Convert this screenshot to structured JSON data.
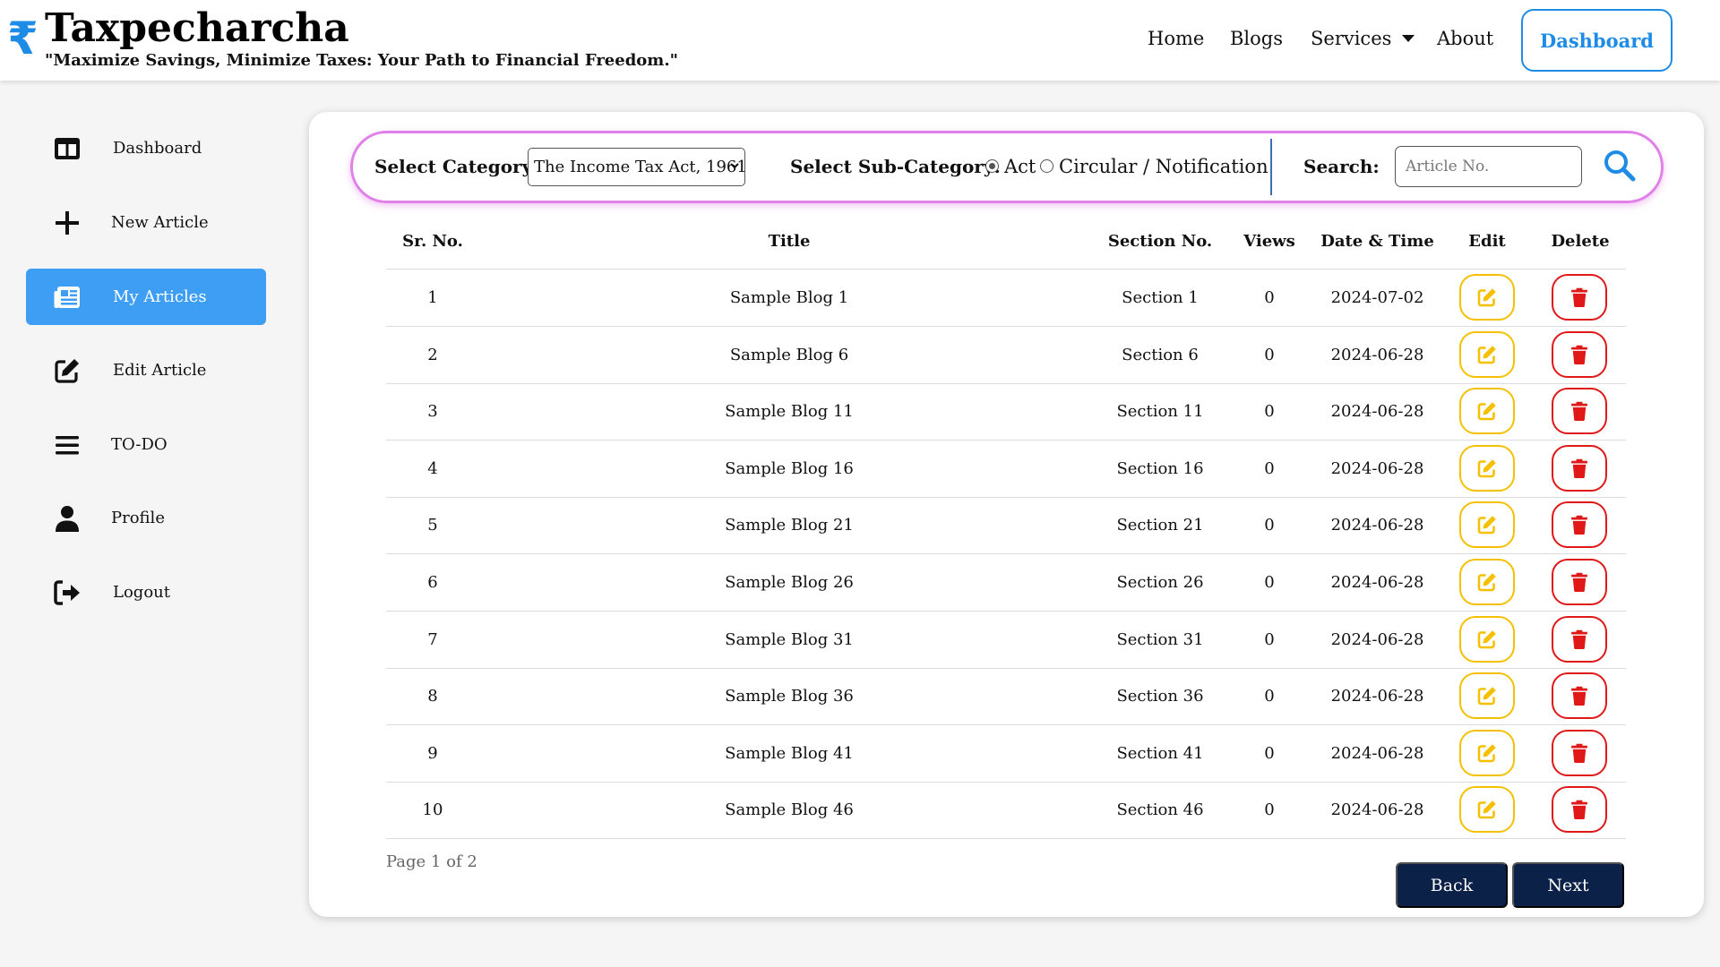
{
  "header": {
    "brand": "Taxpecharcha",
    "logo_glyph": "₹",
    "tagline": "\"Maximize Savings, Minimize Taxes: Your Path to Financial Freedom.\"",
    "nav": {
      "home": "Home",
      "blogs": "Blogs",
      "services": "Services",
      "about": "About"
    },
    "dashboard_button": "Dashboard"
  },
  "sidebar": {
    "items": [
      {
        "label": "Dashboard",
        "icon": "columns-icon"
      },
      {
        "label": "New Article",
        "icon": "plus-icon"
      },
      {
        "label": "My Articles",
        "icon": "newspaper-icon",
        "active": true
      },
      {
        "label": "Edit Article",
        "icon": "edit-icon"
      },
      {
        "label": "TO-DO",
        "icon": "list-icon"
      },
      {
        "label": "Profile",
        "icon": "user-icon"
      },
      {
        "label": "Logout",
        "icon": "logout-icon"
      }
    ]
  },
  "filters": {
    "category_label": "Select Category:",
    "category_value": "The Income Tax Act, 1961",
    "subcategory_label": "Select Sub-Category:",
    "subcategory_options": [
      "Act",
      "Circular / Notification"
    ],
    "subcategory_selected": "Act",
    "search_label": "Search:",
    "search_placeholder": "Article No."
  },
  "table": {
    "columns": [
      "Sr. No.",
      "Title",
      "Section No.",
      "Views",
      "Date & Time",
      "Edit",
      "Delete"
    ],
    "rows": [
      {
        "sr": "1",
        "title": "Sample Blog 1",
        "section": "Section 1",
        "views": "0",
        "date": "2024-07-02"
      },
      {
        "sr": "2",
        "title": "Sample Blog 6",
        "section": "Section 6",
        "views": "0",
        "date": "2024-06-28"
      },
      {
        "sr": "3",
        "title": "Sample Blog 11",
        "section": "Section 11",
        "views": "0",
        "date": "2024-06-28"
      },
      {
        "sr": "4",
        "title": "Sample Blog 16",
        "section": "Section 16",
        "views": "0",
        "date": "2024-06-28"
      },
      {
        "sr": "5",
        "title": "Sample Blog 21",
        "section": "Section 21",
        "views": "0",
        "date": "2024-06-28"
      },
      {
        "sr": "6",
        "title": "Sample Blog 26",
        "section": "Section 26",
        "views": "0",
        "date": "2024-06-28"
      },
      {
        "sr": "7",
        "title": "Sample Blog 31",
        "section": "Section 31",
        "views": "0",
        "date": "2024-06-28"
      },
      {
        "sr": "8",
        "title": "Sample Blog 36",
        "section": "Section 36",
        "views": "0",
        "date": "2024-06-28"
      },
      {
        "sr": "9",
        "title": "Sample Blog 41",
        "section": "Section 41",
        "views": "0",
        "date": "2024-06-28"
      },
      {
        "sr": "10",
        "title": "Sample Blog 46",
        "section": "Section 46",
        "views": "0",
        "date": "2024-06-28"
      }
    ]
  },
  "pagination": {
    "info": "Page 1 of 2",
    "back_label": "Back",
    "next_label": "Next"
  },
  "colors": {
    "accent": "#1e8ce6",
    "active_item": "#3d9ef3",
    "filter_border": "#e080e8",
    "edit": "#f5c000",
    "delete": "#e01818",
    "button_dark": "#0c2148"
  }
}
